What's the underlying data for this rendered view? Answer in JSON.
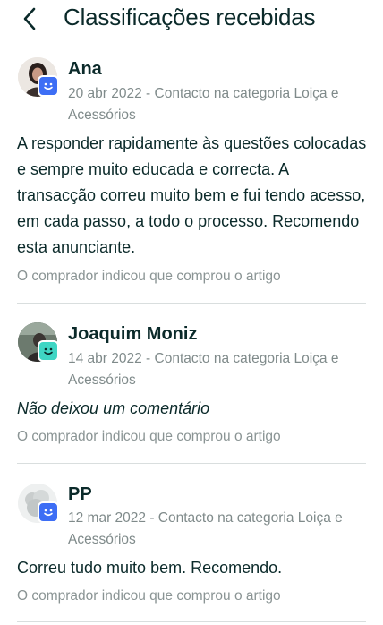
{
  "header": {
    "title": "Classificações recebidas",
    "back_icon": "chevron-left-icon"
  },
  "colors": {
    "text": "#0b2a2a",
    "muted": "#7f8a8a",
    "badge_blue": "#3d6ef5",
    "badge_teal": "#3fd6c4"
  },
  "reviews": [
    {
      "name": "Ana",
      "meta": "20 abr 2022 - Contacto na categoria Loiça e Acessórios",
      "comment": "A responder rapidamente às questões colocadas e sempre muito educada e correcta. A transacção correu muito bem e fui tendo acesso, em cada passo, a todo o processo. Recomendo esta anunciante.",
      "bought": "O comprador indicou que comprou o artigo",
      "badge_color": "#3d6ef5"
    },
    {
      "name": "Joaquim Moniz",
      "meta": "14 abr 2022 - Contacto na categoria Loiça e Acessórios",
      "comment": "Não deixou um comentário",
      "bought": "O comprador indicou que comprou o artigo",
      "badge_color": "#3fd6c4"
    },
    {
      "name": "PP",
      "meta": "12 mar 2022 - Contacto na categoria Loiça e Acessórios",
      "comment": "Correu tudo muito bem. Recomendo.",
      "bought": "O comprador indicou que comprou o artigo",
      "badge_color": "#3d6ef5"
    }
  ]
}
